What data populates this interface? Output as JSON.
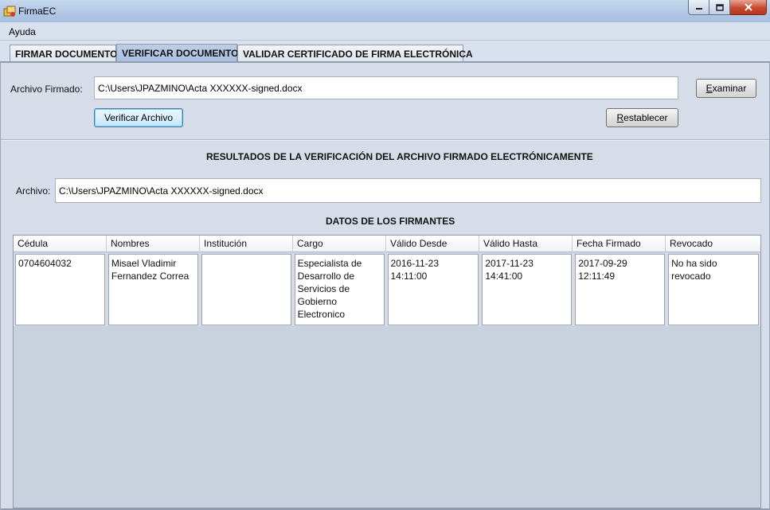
{
  "window": {
    "title": "FirmaEC"
  },
  "menu": {
    "items": [
      "Ayuda"
    ]
  },
  "tabs": [
    {
      "label": "FIRMAR DOCUMENTO",
      "active": false
    },
    {
      "label": "VERIFICAR DOCUMENTO",
      "active": true
    },
    {
      "label": "VALIDAR CERTIFICADO DE FIRMA ELECTRÓNICA",
      "active": false
    }
  ],
  "form": {
    "archivo_firmado_label": "Archivo Firmado:",
    "archivo_firmado_value": "C:\\Users\\JPAZMINO\\Acta XXXXXX-signed.docx",
    "examinar_label": "Examinar",
    "verificar_label": "Verificar Archivo",
    "restablecer_label": "Restablecer"
  },
  "results": {
    "heading": "RESULTADOS DE LA VERIFICACIÓN DEL ARCHIVO FIRMADO ELECTRÓNICAMENTE",
    "archivo_label": "Archivo:",
    "archivo_value": "C:\\Users\\JPAZMINO\\Acta XXXXXX-signed.docx",
    "firmantes_heading": "DATOS DE LOS FIRMANTES"
  },
  "table": {
    "columns": [
      "Cédula",
      "Nombres",
      "Institución",
      "Cargo",
      "Válido Desde",
      "Válido Hasta",
      "Fecha Firmado",
      "Revocado"
    ],
    "rows": [
      [
        "0704604032",
        "Misael Vladimir Fernandez Correa",
        "",
        "Especialista de Desarrollo de Servicios de Gobierno Electronico",
        "2016-11-23 14:11:00",
        "2017-11-23 14:41:00",
        "2017-09-29 12:11:49",
        "No ha sido revocado"
      ]
    ]
  },
  "colors": {
    "accent": "#a9bfe0",
    "close_button": "#c74a2f"
  }
}
